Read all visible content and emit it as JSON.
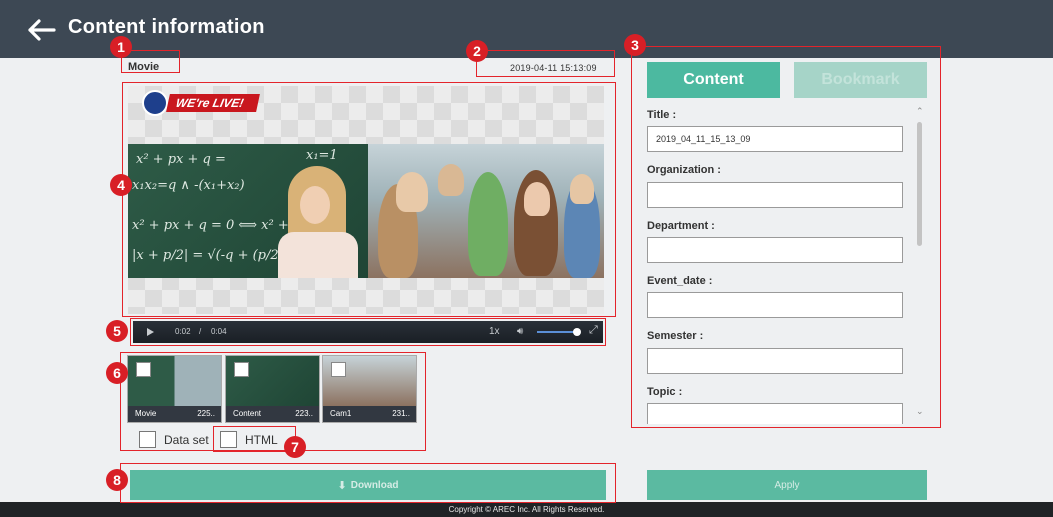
{
  "header": {
    "title": "Content information",
    "back_icon": "arrow-left-icon"
  },
  "annotations": [
    "1",
    "2",
    "3",
    "4",
    "5",
    "6",
    "7",
    "8"
  ],
  "content": {
    "label": "Movie",
    "datetime": "2019-04-11   15:13:09"
  },
  "video": {
    "live_badge": "WE're LIVE!",
    "current_time": "0:02",
    "separator": "/",
    "total_time": "0:04",
    "speed": "1x",
    "volume_level": 0.9
  },
  "thumbnails": [
    {
      "name": "Movie",
      "size": "225..",
      "checked": false
    },
    {
      "name": "Content",
      "size": "223..",
      "checked": false
    },
    {
      "name": "Cam1",
      "size": "231..",
      "checked": false
    }
  ],
  "options": {
    "dataset_label": "Data set",
    "html_label": "HTML"
  },
  "buttons": {
    "download": "Download",
    "apply": "Apply"
  },
  "footer": {
    "copyright": "Copyright © AREC Inc. All Rights Reserved."
  },
  "panel": {
    "tabs": [
      {
        "label": "Content",
        "active": true
      },
      {
        "label": "Bookmark",
        "active": false
      }
    ],
    "fields": [
      {
        "label": "Title :",
        "value": "2019_04_11_15_13_09"
      },
      {
        "label": "Organization :",
        "value": ""
      },
      {
        "label": "Department :",
        "value": ""
      },
      {
        "label": "Event_date :",
        "value": ""
      },
      {
        "label": "Semester :",
        "value": ""
      },
      {
        "label": "Topic :",
        "value": ""
      }
    ]
  },
  "colors": {
    "accent": "#4cb9a0",
    "header": "#3d4854",
    "annotation": "#d81f26"
  }
}
